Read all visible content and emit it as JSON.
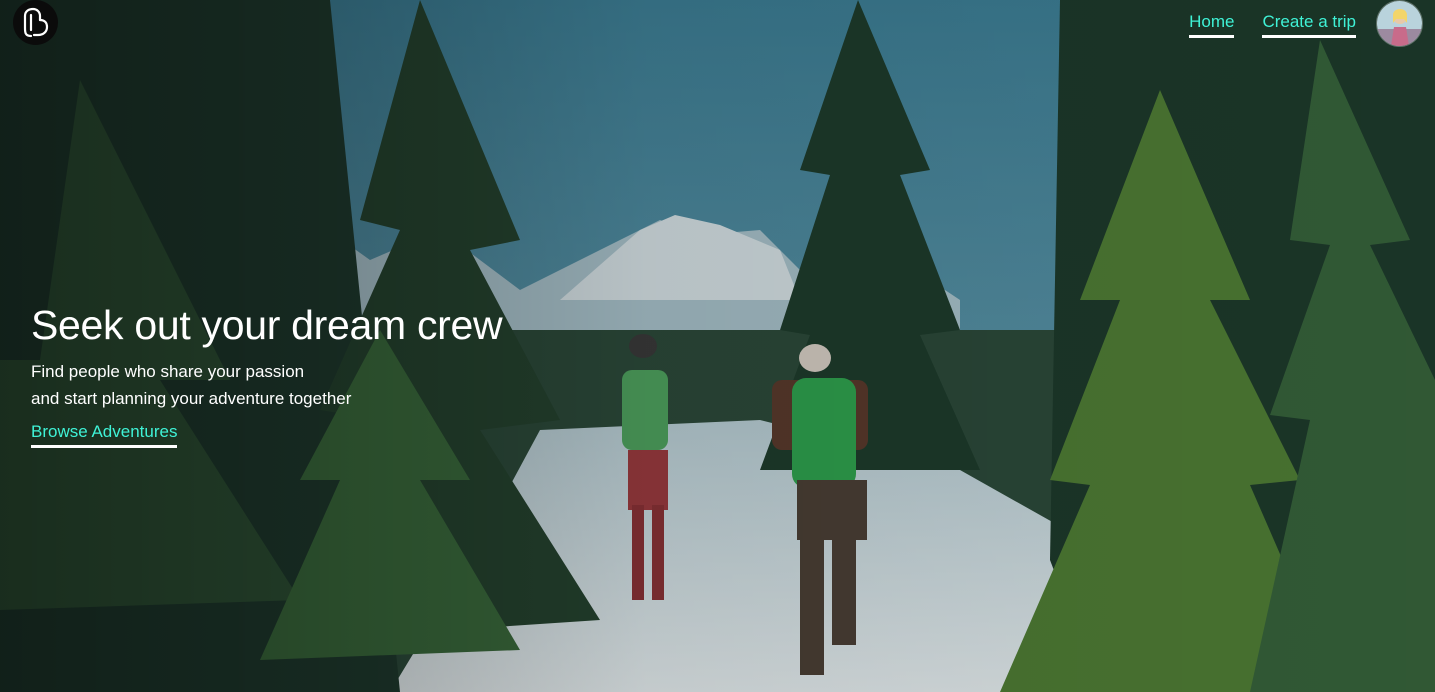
{
  "header": {
    "logo_icon": "carabiner-logo-icon",
    "nav": {
      "home_label": "Home",
      "create_trip_label": "Create a trip"
    },
    "avatar_icon": "user-avatar"
  },
  "hero": {
    "title": "Seek out your dream crew",
    "subtitle_line1": "Find people who share your passion",
    "subtitle_line2": "and start planning your adventure together",
    "cta_label": "Browse Adventures"
  },
  "colors": {
    "accent": "#3ff2d6",
    "underline": "#ffffff",
    "text": "#ffffff"
  }
}
